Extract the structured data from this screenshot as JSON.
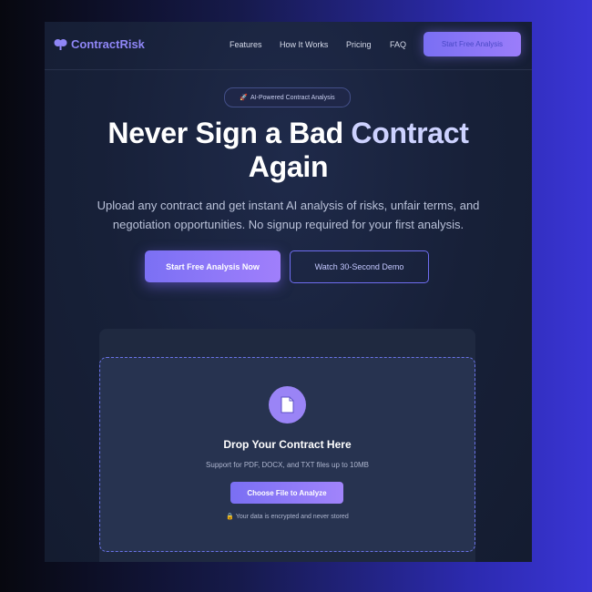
{
  "brand": {
    "name": "ContractRisk",
    "icon": "brain-icon",
    "color": "#8f86f6"
  },
  "nav": {
    "links": [
      "Features",
      "How It Works",
      "Pricing",
      "FAQ"
    ],
    "cta": "Start Free Analysis"
  },
  "hero": {
    "badge": {
      "icon": "rocket-icon",
      "text": "AI-Powered Contract Analysis"
    },
    "headline_part1": "Never Sign a Bad ",
    "headline_accent": "Contract",
    "headline_part2": "Again",
    "subheadline": "Upload any contract and get instant AI analysis of risks, unfair terms, and negotiation opportunities. No signup required for your first analysis.",
    "primary_button": "Start Free Analysis Now",
    "secondary_button": "Watch 30-Second Demo"
  },
  "upload": {
    "icon": "document-icon",
    "title": "Drop Your Contract Here",
    "support_text": "Support for PDF, DOCX, and TXT files up to 10MB",
    "choose_button": "Choose File to Analyze",
    "security_icon": "lock-icon",
    "security_note": "Your data is encrypted and never stored"
  },
  "colors": {
    "accent": "#7b70f4",
    "background": "#172038",
    "headline_accent": "#cdd2ff"
  }
}
